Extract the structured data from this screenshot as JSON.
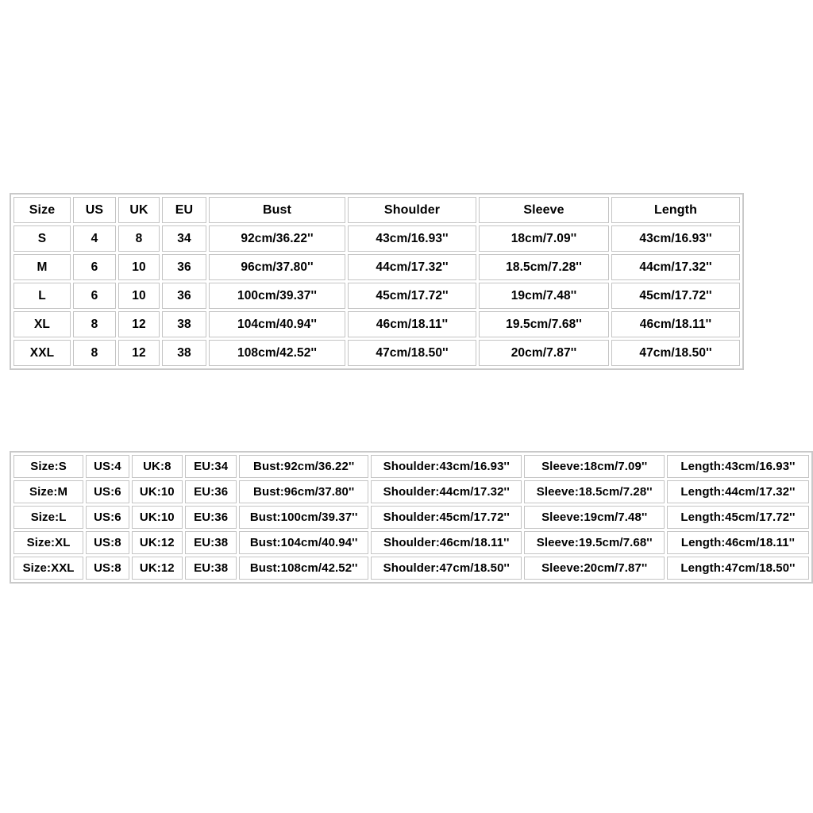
{
  "background_color": "#ffffff",
  "text_color": "#000000",
  "border_color": "#c4c4c4",
  "outer_border_color": "#c9c9c9",
  "table_one": {
    "headers": {
      "size": "Size",
      "us": "US",
      "uk": "UK",
      "eu": "EU",
      "bust": "Bust",
      "shoulder": "Shoulder",
      "sleeve": "Sleeve",
      "length": "Length"
    },
    "rows": [
      {
        "size": "S",
        "us": "4",
        "uk": "8",
        "eu": "34",
        "bust": "92cm/36.22''",
        "shoulder": "43cm/16.93''",
        "sleeve": "18cm/7.09''",
        "length": "43cm/16.93''"
      },
      {
        "size": "M",
        "us": "6",
        "uk": "10",
        "eu": "36",
        "bust": "96cm/37.80''",
        "shoulder": "44cm/17.32''",
        "sleeve": "18.5cm/7.28''",
        "length": "44cm/17.32''"
      },
      {
        "size": "L",
        "us": "6",
        "uk": "10",
        "eu": "36",
        "bust": "100cm/39.37''",
        "shoulder": "45cm/17.72''",
        "sleeve": "19cm/7.48''",
        "length": "45cm/17.72''"
      },
      {
        "size": "XL",
        "us": "8",
        "uk": "12",
        "eu": "38",
        "bust": "104cm/40.94''",
        "shoulder": "46cm/18.11''",
        "sleeve": "19.5cm/7.68''",
        "length": "46cm/18.11''"
      },
      {
        "size": "XXL",
        "us": "8",
        "uk": "12",
        "eu": "38",
        "bust": "108cm/42.52''",
        "shoulder": "47cm/18.50''",
        "sleeve": "20cm/7.87''",
        "length": "47cm/18.50''"
      }
    ]
  },
  "table_two": {
    "rows": [
      {
        "size": "Size:S",
        "us": "US:4",
        "uk": "UK:8",
        "eu": "EU:34",
        "bust": "Bust:92cm/36.22''",
        "shoulder": "Shoulder:43cm/16.93''",
        "sleeve": "Sleeve:18cm/7.09''",
        "length": "Length:43cm/16.93''"
      },
      {
        "size": "Size:M",
        "us": "US:6",
        "uk": "UK:10",
        "eu": "EU:36",
        "bust": "Bust:96cm/37.80''",
        "shoulder": "Shoulder:44cm/17.32''",
        "sleeve": "Sleeve:18.5cm/7.28''",
        "length": "Length:44cm/17.32''"
      },
      {
        "size": "Size:L",
        "us": "US:6",
        "uk": "UK:10",
        "eu": "EU:36",
        "bust": "Bust:100cm/39.37''",
        "shoulder": "Shoulder:45cm/17.72''",
        "sleeve": "Sleeve:19cm/7.48''",
        "length": "Length:45cm/17.72''"
      },
      {
        "size": "Size:XL",
        "us": "US:8",
        "uk": "UK:12",
        "eu": "EU:38",
        "bust": "Bust:104cm/40.94''",
        "shoulder": "Shoulder:46cm/18.11''",
        "sleeve": "Sleeve:19.5cm/7.68''",
        "length": "Length:46cm/18.11''"
      },
      {
        "size": "Size:XXL",
        "us": "US:8",
        "uk": "UK:12",
        "eu": "EU:38",
        "bust": "Bust:108cm/42.52''",
        "shoulder": "Shoulder:47cm/18.50''",
        "sleeve": "Sleeve:20cm/7.87''",
        "length": "Length:47cm/18.50''"
      }
    ]
  }
}
